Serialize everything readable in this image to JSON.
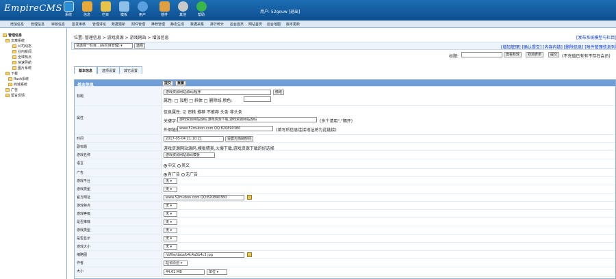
{
  "app": {
    "logo": "EmpireCMS",
    "user_text": "用户: 52gouw [退出]"
  },
  "top_icons": [
    {
      "label": "系统",
      "color": "#2b8fd8",
      "icon": "system-icon"
    },
    {
      "label": "信息",
      "color": "#e8a936",
      "icon": "info-icon"
    },
    {
      "label": "栏目",
      "color": "#e8c24a",
      "icon": "column-icon"
    },
    {
      "label": "模板",
      "color": "#8cc0e8",
      "icon": "template-icon"
    },
    {
      "label": "用户",
      "color": "#5aa0e0",
      "icon": "user-icon"
    },
    {
      "label": "插件",
      "color": "#e0a040",
      "icon": "plugin-icon"
    },
    {
      "label": "其他",
      "color": "#c8c8c8",
      "icon": "other-icon"
    },
    {
      "label": "帮助",
      "color": "#3ab54a",
      "icon": "help-icon"
    }
  ],
  "menu": [
    "增加信息",
    "管理信息",
    "审核信息",
    "签发审核",
    "管理评论",
    "数据更新",
    "附件管理",
    "推荐管理",
    "静态生成",
    "数据采集",
    "排行统计",
    "后台首页",
    "网站首页",
    "后台地图",
    "版本更新"
  ],
  "sidebar": {
    "items": [
      "管理信息",
      "文章系统",
      "公司动态",
      "业内新闻",
      "全球热点",
      "快速导航",
      "图片系统",
      "下载",
      "flash系统",
      "商城系统",
      "广告",
      "留言反馈"
    ]
  },
  "breadcrumb": "位置: 管理信息 > 游戏资源 > 游戏网站 > 增加信息",
  "top_right_link": "[发布系统模型与栏目]",
  "toolbar": {
    "select_value": "请选择一栏目...(在栏目管理)",
    "select_button": "选择",
    "right_links": "[增加管理] [确认提交] [内容内链] [删除信息] [附件管理信息列表]",
    "title_label": "标题:",
    "search_btn": "查看有效",
    "sort_btn": "取消表单",
    "submit_btn": "提交",
    "note": "(不充值已有有不存在会员)"
  },
  "tabs": [
    "基本信息",
    "选项设置",
    "其它设置"
  ],
  "form": {
    "header": "基本信息",
    "header_btn1": "提交",
    "header_btn2": "重置",
    "title_label": "标题",
    "title_value": "游戏资源网站源码/程序",
    "title_btn": "修改",
    "title_attrs": "属性: □ 加粗 □ 斜体 □ 删除线  颜色:",
    "prop_label": "属性",
    "prop_line1": "信息属性: ☑ 审核  推荐 不推荐  头条 非头条",
    "keyword_label": "关键字:",
    "keyword_value": "游戏资源网站源码,游戏资源下载,游戏资源网站源码",
    "keyword_note": "(多个请用\",\"隔开)",
    "link_label": "外部链接:",
    "link_value": "www.52mubon.com QQ:820890380",
    "link_note": "(填写后信息连接地址将为此链接)",
    "time_label": "时间",
    "time_value": "2017-05-04 21:10:21",
    "time_btn": "设置为当前时间",
    "title2_label": "副标题",
    "title2_value": "游戏资源网站源码,模板精美,火爆下载,游戏资源下载的好选择",
    "smalltext_label": "游戏名称",
    "smalltext_value": "游戏资源网站源码模板",
    "lang_label": "语言",
    "lang_opt1": "中文",
    "lang_opt2": "英文",
    "ad_label": "广告",
    "ad_opt1": "有广告",
    "ad_opt2": "无广告",
    "platform_label": "游戏平台",
    "platform_value": "无",
    "category_label": "游戏类型",
    "category_value": "无",
    "url_label": "官方网址",
    "url_value": "www.52mubon.com QQ:820890380",
    "r1_label": "游戏特点",
    "r1_value": "无",
    "r2_label": "游戏等级",
    "r2_value": "无",
    "r3_label": "是否推荐",
    "r3_value": "无",
    "r4_label": "游戏类型",
    "r4_value": "无",
    "r5_label": "是否显示",
    "r5_value": "无",
    "r6_label": "游戏大小",
    "r6_value": "无",
    "img_label": "缩略图",
    "img_value": "/d/file/data/b4c4a5b4c3.jpg",
    "author_label": "作者",
    "author_value": "站长原创",
    "size_label": "大小",
    "size_value": "44.61 MB",
    "size_unit": "单位"
  }
}
